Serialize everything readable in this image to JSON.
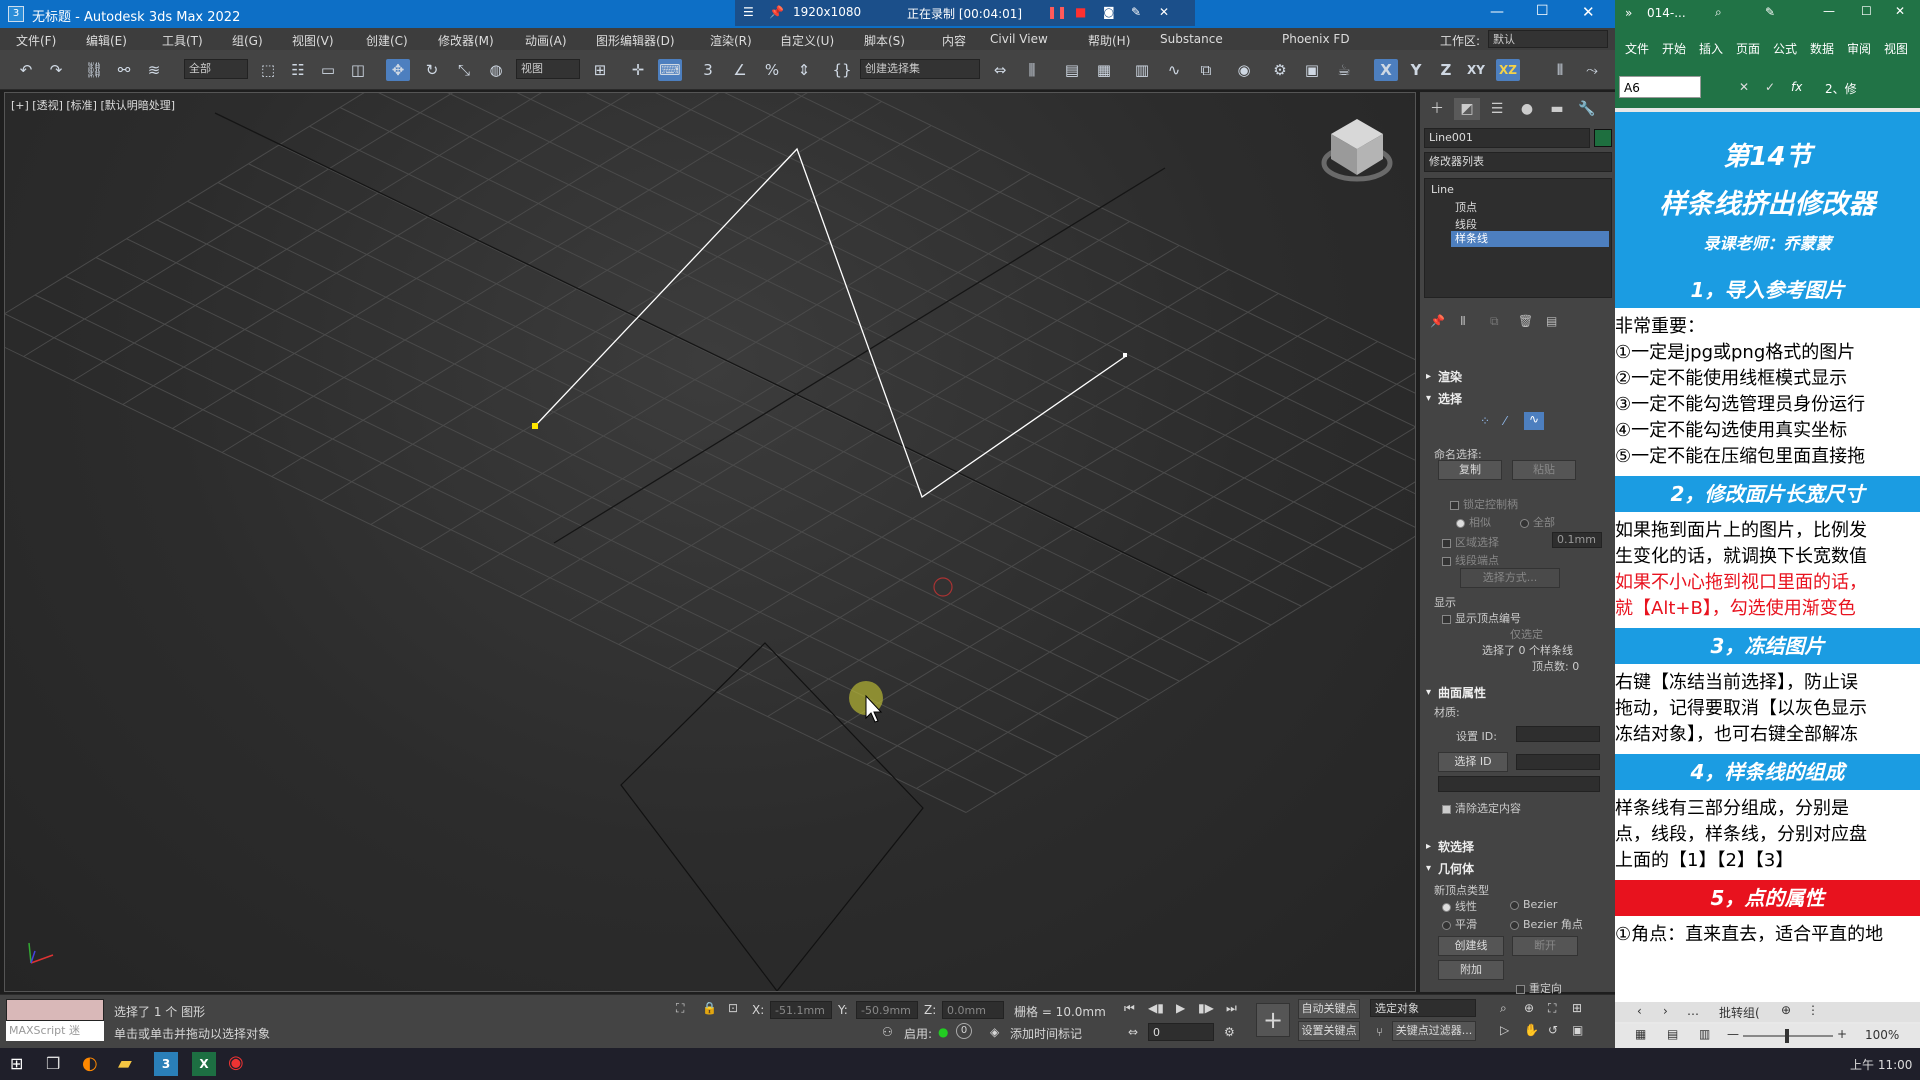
{
  "titlebar": {
    "title": "无标题 - Autodesk 3ds Max 2022",
    "app_icon": "3"
  },
  "recording": {
    "resolution": "1920x1080",
    "status": "正在录制 [00:04:01]"
  },
  "menubar": {
    "items": [
      "文件(F)",
      "编辑(E)",
      "工具(T)",
      "组(G)",
      "视图(V)",
      "创建(C)",
      "修改器(M)",
      "动画(A)",
      "图形编辑器(D)",
      "渲染(R)",
      "自定义(U)",
      "脚本(S)",
      "内容",
      "Civil View",
      "帮助(H)",
      "Substance",
      "Phoenix FD"
    ],
    "workspace_label": "工作区:",
    "workspace_value": "默认"
  },
  "toolbar": {
    "filter_value": "全部",
    "view_value": "视图",
    "selection_set": "创建选择集",
    "axis_x": "X",
    "axis_y": "Y",
    "axis_z": "Z",
    "axis_xy": "XY",
    "axis_xz": "XZ"
  },
  "viewport": {
    "label": "[+] [透视] [标准] [默认明暗处理]"
  },
  "cmdpanel": {
    "object_name": "Line001",
    "modifier_list": "修改器列表",
    "stack": {
      "root": "Line",
      "items": [
        "顶点",
        "线段",
        "样条线"
      ]
    },
    "rollouts": {
      "render": "渲染",
      "select": "选择",
      "surface": "曲面属性",
      "soft": "软选择",
      "geometry": "几何体"
    },
    "select": {
      "named_label": "命名选择:",
      "copy": "复制",
      "paste": "粘贴",
      "lock_handles": "锁定控制柄",
      "similar": "相似",
      "all": "全部",
      "area_select": "区域选择",
      "area_value": "0.1mm",
      "seg_end": "线段端点",
      "select_by": "选择方式...",
      "display": "显示",
      "show_vertex_num": "显示顶点编号",
      "only_selected": "仅选定",
      "selected_count": "选择了 0 个样条线",
      "vertex_count": "顶点数: 0"
    },
    "surface": {
      "material": "材质:",
      "set_id": "设置 ID:",
      "select_id": "选择 ID",
      "clear_sel": "清除选定内容"
    },
    "geometry": {
      "new_vertex_type": "新顶点类型",
      "linear": "线性",
      "bezier": "Bezier",
      "smooth": "平滑",
      "bezier_corner": "Bezier 角点",
      "create_line": "创建线",
      "break": "断开",
      "attach": "附加",
      "reorient": "重定向"
    }
  },
  "status": {
    "maxscript": "MAXScript 迷",
    "selected": "选择了 1 个 图形",
    "hint": "单击或单击并拖动以选择对象",
    "x_label": "X:",
    "x_value": "-51.1mm",
    "y_label": "Y:",
    "y_value": "-50.9mm",
    "z_label": "Z:",
    "z_value": "0.0mm",
    "grid": "栅格 = 10.0mm",
    "enable": "启用:",
    "add_time_tag": "添加时间标记",
    "auto_key": "自动关键点",
    "set_key": "设置关键点",
    "key_filter": "关键点过滤器...",
    "selected_obj": "选定对象",
    "frame": "0"
  },
  "taskbar": {
    "time": "上午 11:00"
  },
  "excel": {
    "tab_label": "014-...",
    "ribbon": [
      "文件",
      "开始",
      "插入",
      "页面",
      "公式",
      "数据",
      "审阅",
      "视图"
    ],
    "cell_ref": "A6",
    "fx": "fx",
    "formula_preview": "2、修",
    "title1": "第14节",
    "title2": "样条线挤出修改器",
    "teacher": "录课老师：乔蒙蒙",
    "sections": [
      {
        "head": "1，导入参考图片",
        "red": false,
        "lines": [
          {
            "t": "非常重要：",
            "red": false
          },
          {
            "t": "①一定是jpg或png格式的图片",
            "red": false
          },
          {
            "t": "②一定不能使用线框模式显示",
            "red": false
          },
          {
            "t": "③一定不能勾选管理员身份运行",
            "red": false
          },
          {
            "t": "④一定不能勾选使用真实坐标",
            "red": false
          },
          {
            "t": "⑤一定不能在压缩包里面直接拖",
            "red": false
          }
        ]
      },
      {
        "head": "2，修改面片长宽尺寸",
        "red": false,
        "lines": [
          {
            "t": "如果拖到面片上的图片，比例发",
            "red": false
          },
          {
            "t": "生变化的话，就调换下长宽数值",
            "red": false
          },
          {
            "t": "如果不小心拖到视口里面的话，",
            "red": true
          },
          {
            "t": "就【Alt+B】，勾选使用渐变色",
            "red": true
          }
        ]
      },
      {
        "head": "3，冻结图片",
        "red": false,
        "lines": [
          {
            "t": "右键【冻结当前选择】，防止误",
            "red": false
          },
          {
            "t": "拖动，记得要取消【以灰色显示",
            "red": false
          },
          {
            "t": "冻结对象】，也可右键全部解冻",
            "red": false
          }
        ]
      },
      {
        "head": "4，样条线的组成",
        "red": false,
        "lines": [
          {
            "t": "样条线有三部分组成，分别是",
            "red": false
          },
          {
            "t": "点，线段，样条线，分别对应盘",
            "red": false
          },
          {
            "t": "上面的【1】【2】【3】",
            "red": false
          }
        ]
      },
      {
        "head": "5，点的属性",
        "red": true,
        "lines": [
          {
            "t": "①角点：直来直去，适合平直的地",
            "red": false
          }
        ]
      }
    ],
    "status_mode": "批转组(",
    "zoom": "100%"
  }
}
